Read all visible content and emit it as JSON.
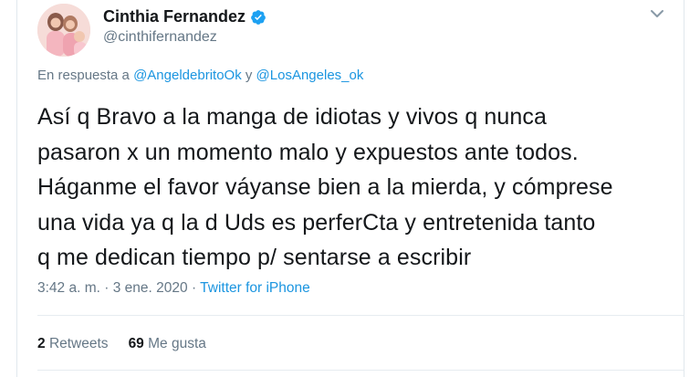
{
  "tweet": {
    "author": {
      "display_name": "Cinthia Fernandez",
      "handle": "@cinthifernandez",
      "verified_icon": "verified-badge-icon",
      "avatar_icon": "avatar"
    },
    "reply_prefix": "En respuesta a",
    "reply_mentions": [
      "@AngeldebritoOk",
      "@LosAngeles_ok"
    ],
    "reply_conjunction": "y",
    "text_lines": [
      "Así q Bravo a la manga de idiotas y vivos q nunca",
      "pasaron x un momento malo y expuestos ante todos.",
      "Háganme el favor váyanse bien a la mierda, y cómprese",
      "una vida ya q la d Uds es perferCta y entretenida tanto",
      "q me dedican tiempo p/ sentarse a escribir"
    ],
    "time": "3:42 a. m.",
    "separator": "·",
    "date": "3 ene. 2020",
    "source": "Twitter for iPhone",
    "retweets_count": "2",
    "retweets_label": "Retweets",
    "likes_count": "69",
    "likes_label": "Me gusta",
    "caret_icon": "chevron-down-icon"
  },
  "colors": {
    "accent": "#1b95e0",
    "text": "#14171a",
    "secondary": "#657786",
    "verified": "#1da1f2"
  }
}
